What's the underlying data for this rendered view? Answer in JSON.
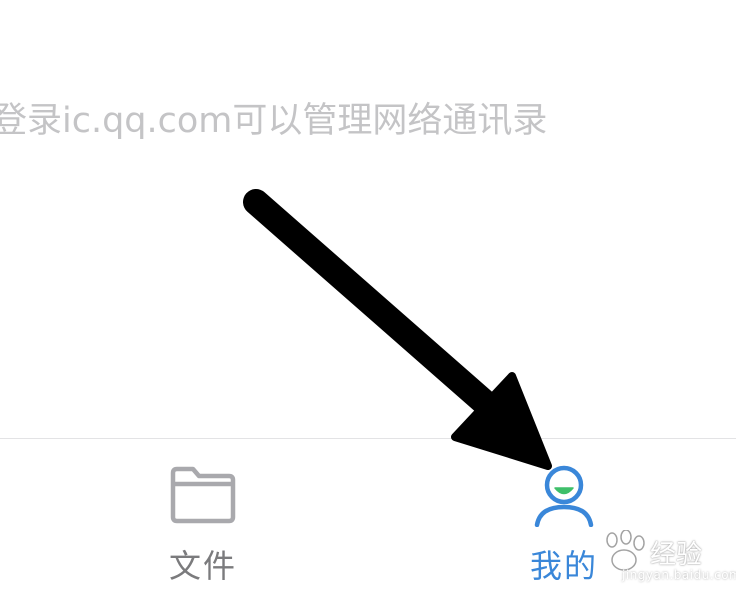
{
  "main": {
    "hint_text": "登录ic.qq.com可以管理网络通讯录"
  },
  "tab_bar": {
    "tabs": [
      {
        "label": "文件",
        "icon": "folder-icon",
        "active": false
      },
      {
        "label": "我的",
        "icon": "user-icon",
        "active": true
      }
    ]
  },
  "colors": {
    "active": "#3a87d9",
    "inactive": "#7b7b7d",
    "accent_green": "#3fbf6a",
    "hint": "#c4c4c6",
    "annotation_arrow": "#000000"
  },
  "watermark": {
    "brand": "经验",
    "site": "jingyan.baidu.com",
    "logo": "paw-logo"
  }
}
